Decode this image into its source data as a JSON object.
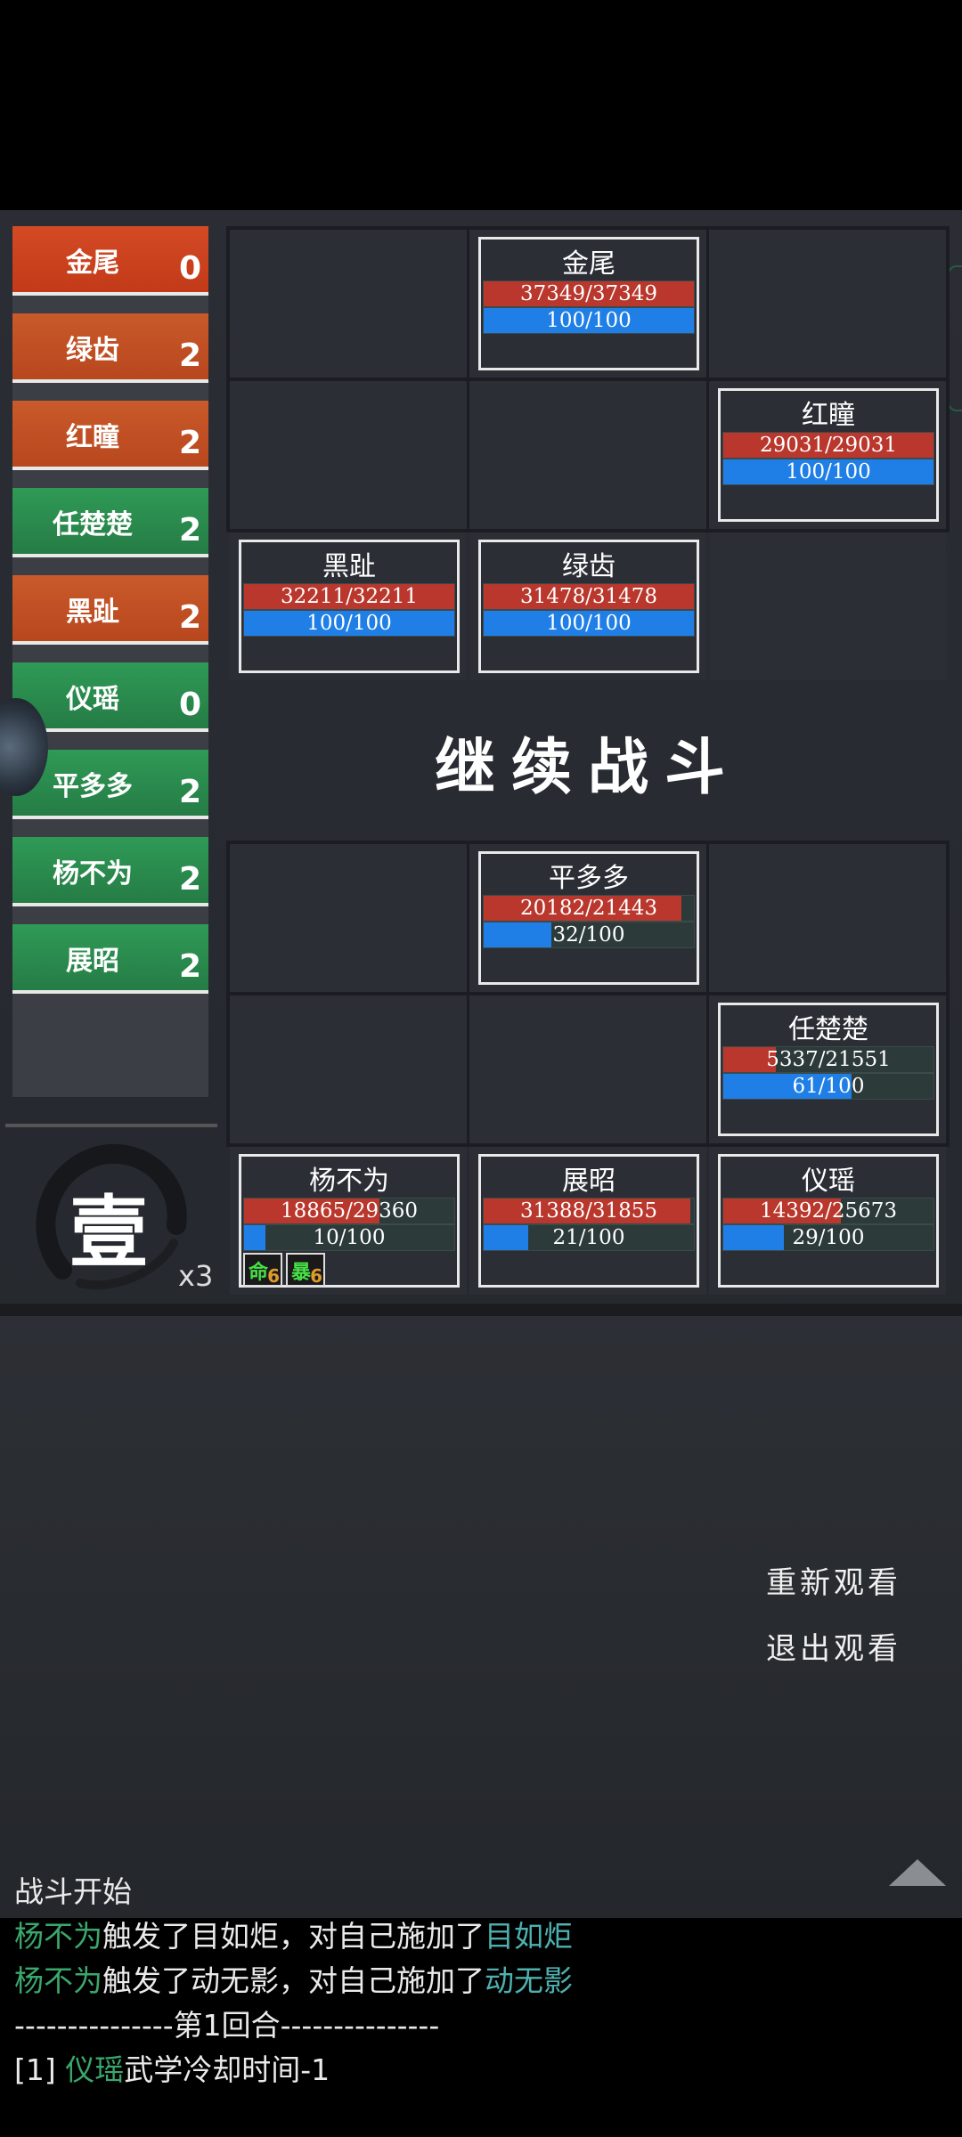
{
  "turn_order": [
    {
      "name": "金尾",
      "count": "0",
      "side": "enemy",
      "active": true
    },
    {
      "name": "绿齿",
      "count": "2",
      "side": "enemy"
    },
    {
      "name": "红瞳",
      "count": "2",
      "side": "enemy"
    },
    {
      "name": "任楚楚",
      "count": "2",
      "side": "ally"
    },
    {
      "name": "黑趾",
      "count": "2",
      "side": "enemy"
    },
    {
      "name": "仪瑶",
      "count": "0",
      "side": "ally"
    },
    {
      "name": "平多多",
      "count": "2",
      "side": "ally"
    },
    {
      "name": "杨不为",
      "count": "2",
      "side": "ally"
    },
    {
      "name": "展昭",
      "count": "2",
      "side": "ally"
    }
  ],
  "round": {
    "label": "壹",
    "speed": "x3"
  },
  "enemy_units": [
    {
      "name": "金尾",
      "hp": "37349/37349",
      "mp": "100/100",
      "hp_frac": 1.0,
      "mp_frac": 1.0
    },
    {
      "name": "红瞳",
      "hp": "29031/29031",
      "mp": "100/100",
      "hp_frac": 1.0,
      "mp_frac": 1.0
    },
    {
      "name": "黑趾",
      "hp": "32211/32211",
      "mp": "100/100",
      "hp_frac": 1.0,
      "mp_frac": 1.0
    },
    {
      "name": "绿齿",
      "hp": "31478/31478",
      "mp": "100/100",
      "hp_frac": 1.0,
      "mp_frac": 1.0
    }
  ],
  "ally_units": [
    {
      "name": "平多多",
      "hp": "20182/21443",
      "mp": "32/100",
      "hp_frac": 0.941,
      "mp_frac": 0.32
    },
    {
      "name": "任楚楚",
      "hp": "5337/21551",
      "mp": "61/100",
      "hp_frac": 0.248,
      "mp_frac": 0.61
    },
    {
      "name": "杨不为",
      "hp": "18865/29360",
      "mp": "10/100",
      "hp_frac": 0.643,
      "mp_frac": 0.1,
      "buffs": [
        {
          "char": "命",
          "count": "6"
        },
        {
          "char": "暴",
          "count": "6"
        }
      ]
    },
    {
      "name": "展昭",
      "hp": "31388/31855",
      "mp": "21/100",
      "hp_frac": 0.985,
      "mp_frac": 0.21
    },
    {
      "name": "仪瑶",
      "hp": "14392/25673",
      "mp": "29/100",
      "hp_frac": 0.561,
      "mp_frac": 0.29
    }
  ],
  "continue_label": "继续战斗",
  "menu": {
    "replay": "重新观看",
    "exit": "退出观看"
  },
  "log": {
    "line1": "战斗开始",
    "line2": {
      "actor": "杨不为",
      "mid": "触发了目如炬，对自己施加了",
      "skill": "目如炬"
    },
    "line3": {
      "actor": "杨不为",
      "mid": "触发了动无影，对自己施加了",
      "skill": "动无影"
    },
    "line4": "---------------第1回合---------------",
    "line5": {
      "prefix": "[1] ",
      "actor": "仪瑶",
      "text": "武学冷却时间-1"
    }
  },
  "colors": {
    "enemy": "#c95a2a",
    "ally": "#2f9a56",
    "hp": "#b9372c",
    "mp": "#1f7fe6",
    "highlight": "#3aa76c"
  }
}
